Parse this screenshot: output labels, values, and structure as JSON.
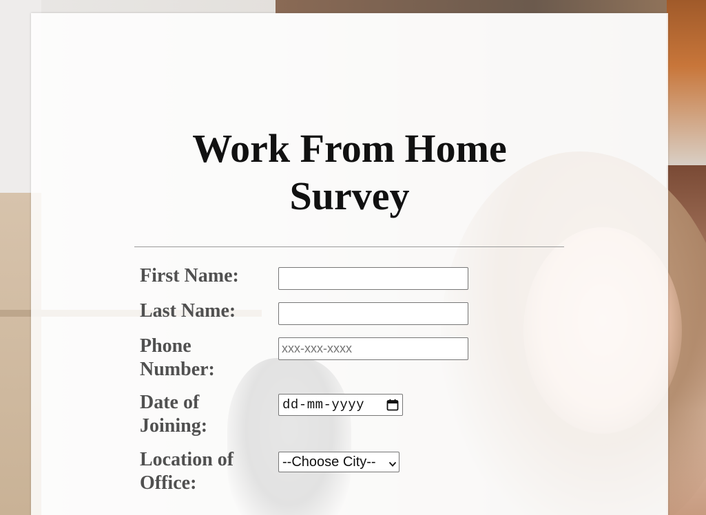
{
  "form": {
    "title_line1": "Work From Home",
    "title_line2": "Survey",
    "fields": {
      "first_name": {
        "label": "First Name:",
        "value": "",
        "placeholder": ""
      },
      "last_name": {
        "label": "Last Name:",
        "value": "",
        "placeholder": ""
      },
      "phone": {
        "label": "Phone Number:",
        "value": "",
        "placeholder": "xxx-xxx-xxxx"
      },
      "date_of_joining": {
        "label": "Date of Joining:",
        "display": "dd-mm-yyyy",
        "icon": "calendar-icon"
      },
      "office_location": {
        "label": "Location of Office:",
        "selected": "--Choose City--",
        "icon": "chevron-down-icon"
      }
    }
  },
  "colors": {
    "title": "#111111",
    "label": "#505050",
    "card_background": "rgba(255,255,255,0.85)",
    "divider": "#9a9a9a"
  }
}
